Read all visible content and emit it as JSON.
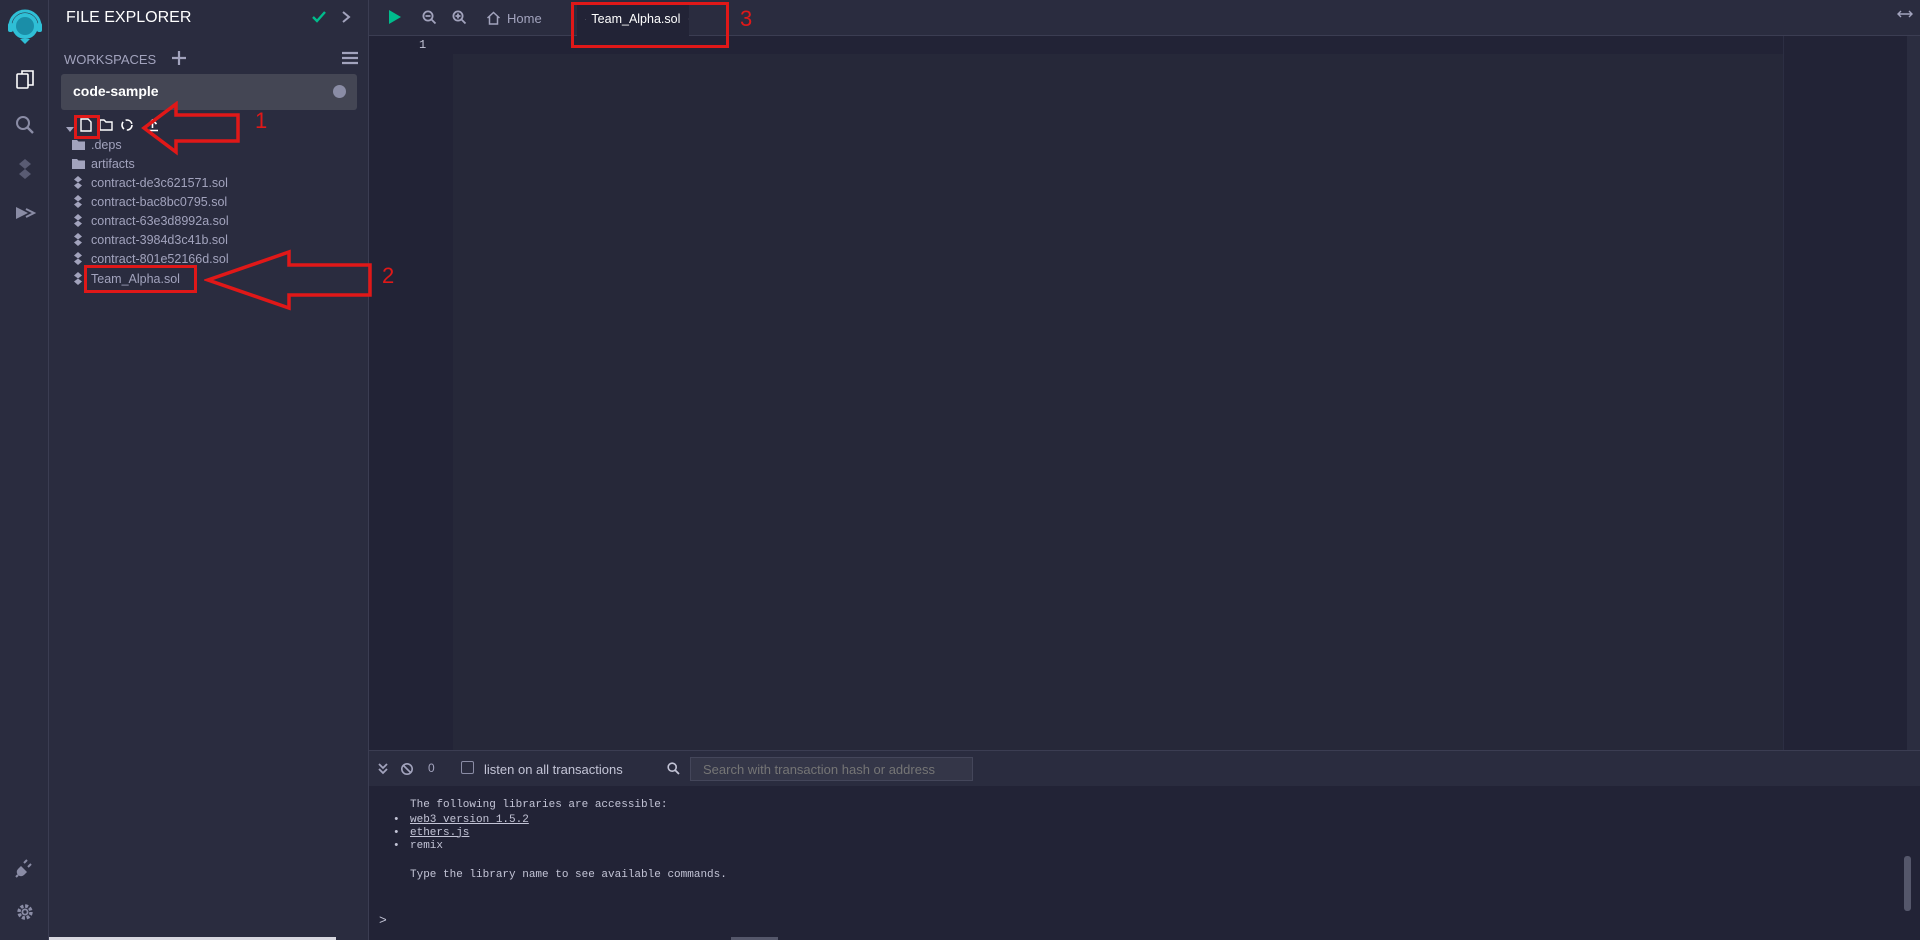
{
  "side_panel": {
    "title": "FILE EXPLORER",
    "workspaces_label": "WORKSPACES",
    "workspace_selected": "code-sample",
    "tree": [
      {
        "label": ".deps",
        "kind": "folder"
      },
      {
        "label": "artifacts",
        "kind": "folder"
      },
      {
        "label": "contract-de3c621571.sol",
        "kind": "file"
      },
      {
        "label": "contract-bac8bc0795.sol",
        "kind": "file"
      },
      {
        "label": "contract-63e3d8992a.sol",
        "kind": "file"
      },
      {
        "label": "contract-3984d3c41b.sol",
        "kind": "file"
      },
      {
        "label": "contract-801e52166d.sol",
        "kind": "file"
      },
      {
        "label": "Team_Alpha.sol",
        "kind": "file"
      }
    ]
  },
  "tabs": {
    "home": "Home",
    "active": "Team_Alpha.sol"
  },
  "editor": {
    "line_number": "1"
  },
  "terminal": {
    "count": "0",
    "listen_label": "listen on all transactions",
    "search_placeholder": "Search with transaction hash or address",
    "intro": "The following libraries are accessible:",
    "libs": [
      "web3 version 1.5.2",
      "ethers.js",
      "remix"
    ],
    "hint": "Type the library name to see available commands.",
    "prompt": ">"
  },
  "annotations": {
    "label_1": "1",
    "label_2": "2",
    "label_3": "3"
  },
  "colors": {
    "accent": "#2fbfd6",
    "annotation": "#e01818",
    "success": "#00bc8c"
  }
}
